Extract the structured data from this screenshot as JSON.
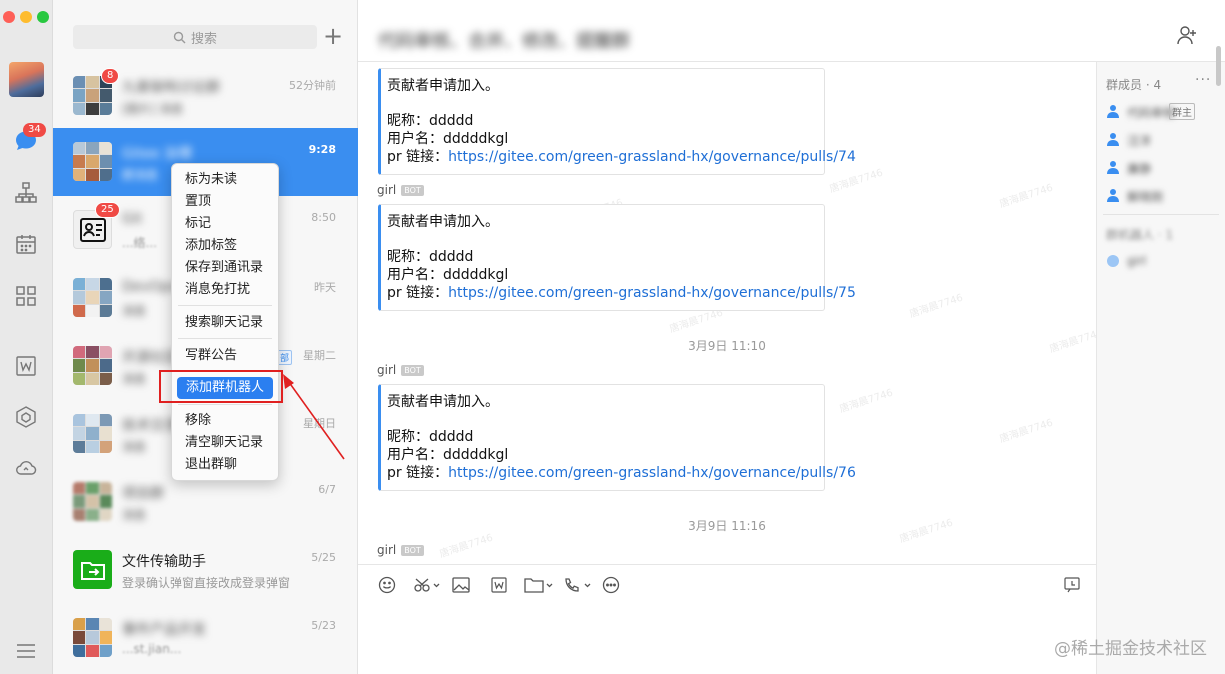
{
  "search": {
    "placeholder": "搜索"
  },
  "rail": {
    "badge": "34"
  },
  "conversations": [
    {
      "name": "九章架构讨论群",
      "preview": "[图片] 消息",
      "time": "52分钟前",
      "badge": "8"
    },
    {
      "name": "Gitee 治理",
      "preview": "群消息",
      "time": "9:28"
    },
    {
      "name": "Git",
      "preview": "...络...",
      "time": "8:50",
      "badge": "25"
    },
    {
      "name": "DevOps",
      "preview": "消息",
      "time": "昨天"
    },
    {
      "name": "开源社区",
      "preview": "消息",
      "time": "星期二",
      "tag": "部"
    },
    {
      "name": "技术交流",
      "preview": "消息",
      "time": "星期日"
    },
    {
      "name": "项目群",
      "preview": "消息",
      "time": "6/7"
    },
    {
      "name": "文件传输助手",
      "preview": "登录确认弹窗直接改成登录弹窗",
      "time": "5/25"
    },
    {
      "name": "事件产品开发",
      "preview": "...st.jian...",
      "time": "5/23"
    }
  ],
  "context_menu": {
    "items": [
      "标为未读",
      "置顶",
      "标记",
      "添加标签",
      "保存到通讯录",
      "消息免打扰",
      "搜索聊天记录",
      "写群公告",
      "添加群机器人",
      "移除",
      "清空聊天记录",
      "退出群聊"
    ]
  },
  "chat": {
    "title": "代码审核、合并、修改、提醒群",
    "messages": [
      {
        "headline": "贡献者申请加入。",
        "nick_label": "昵称：",
        "nick": "ddddd",
        "user_label": "用户名：",
        "user": "dddddkgl",
        "link_label": "pr 链接：",
        "link": "https://gitee.com/green-grassland-hx/governance/pulls/74"
      },
      {
        "sender": "girl",
        "bot": "BOT",
        "headline": "贡献者申请加入。",
        "nick_label": "昵称：",
        "nick": "ddddd",
        "user_label": "用户名：",
        "user": "dddddkgl",
        "link_label": "pr 链接：",
        "link": "https://gitee.com/green-grassland-hx/governance/pulls/75"
      },
      {
        "stamp": "3月9日 11:10",
        "sender": "girl",
        "bot": "BOT",
        "headline": "贡献者申请加入。",
        "nick_label": "昵称：",
        "nick": "ddddd",
        "user_label": "用户名：",
        "user": "dddddkgl",
        "link_label": "pr 链接：",
        "link": "https://gitee.com/green-grassland-hx/governance/pulls/76"
      }
    ],
    "last_stamp": "3月9日 11:16",
    "last_sender": "girl",
    "last_bot": "BOT",
    "watermark": "唐海晨7746"
  },
  "members": {
    "title": "群成员 · 4",
    "more": "···",
    "list": [
      {
        "name": "代码审核",
        "tag": "群主"
      },
      {
        "name": "汪洋"
      },
      {
        "name": "廉静"
      },
      {
        "name": "解晓刚"
      }
    ],
    "bot_section": "群机器人 · 1",
    "bot_name": "girl"
  },
  "site_watermark": "@稀土掘金技术社区"
}
